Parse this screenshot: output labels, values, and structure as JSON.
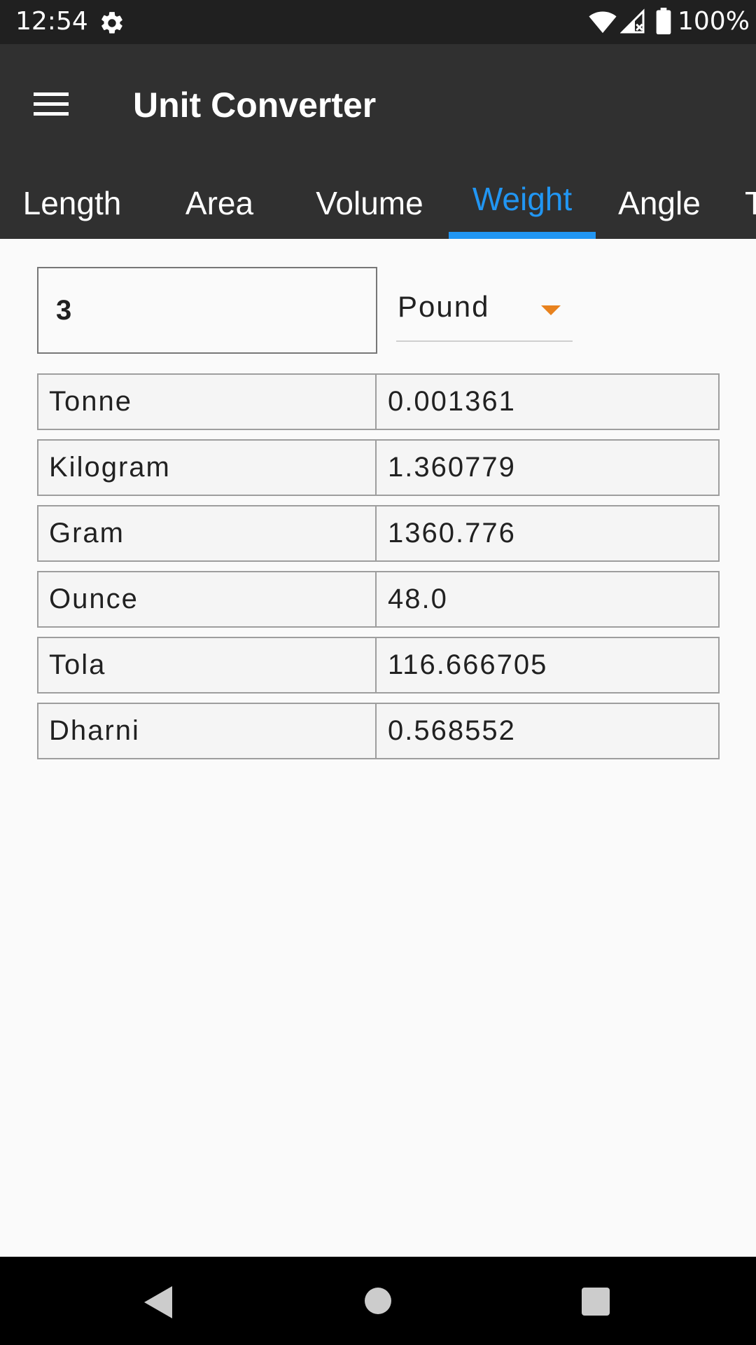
{
  "status_bar": {
    "time": "12:54",
    "battery_percent": "100%",
    "icons": [
      "gear-icon",
      "wifi-icon",
      "signal-icon",
      "battery-icon"
    ]
  },
  "app_bar": {
    "title": "Unit Converter",
    "menu_icon": "hamburger-menu-icon"
  },
  "tabs": [
    {
      "label": "Length",
      "active": false
    },
    {
      "label": "Area",
      "active": false
    },
    {
      "label": "Volume",
      "active": false
    },
    {
      "label": "Weight",
      "active": true
    },
    {
      "label": "Angle",
      "active": false
    },
    {
      "label": "T",
      "active": false
    }
  ],
  "converter": {
    "input_value": "3",
    "selected_unit": "Pound",
    "results": [
      {
        "unit": "Tonne",
        "value": "0.001361"
      },
      {
        "unit": "Kilogram",
        "value": "1.360779"
      },
      {
        "unit": "Gram",
        "value": "1360.776"
      },
      {
        "unit": "Ounce",
        "value": "48.0"
      },
      {
        "unit": "Tola",
        "value": "116.666705"
      },
      {
        "unit": "Dharni",
        "value": "0.568552"
      }
    ]
  },
  "colors": {
    "accent": "#2196f3",
    "dropdown_arrow": "#e8821e",
    "app_bar": "#303030",
    "status_bar": "#202020"
  },
  "nav_bar": {
    "icons": [
      "back-icon",
      "home-icon",
      "recents-icon"
    ]
  }
}
